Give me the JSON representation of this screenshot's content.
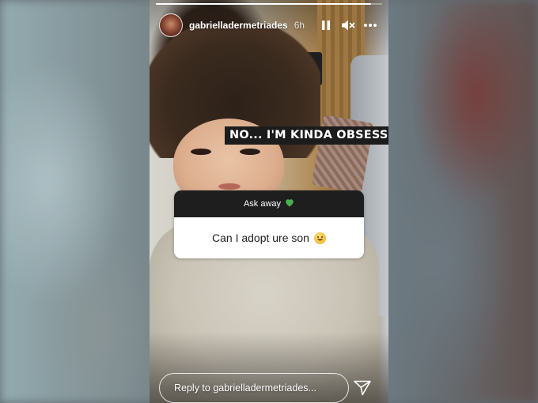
{
  "story": {
    "username": "gabrielladermetriades",
    "time_ago": "6h",
    "progress": 0.95,
    "text_sticker": "NO... I'M KINDA OBSESSED",
    "question": {
      "prompt": "Ask away",
      "answer": "Can I adopt ure son"
    },
    "reply_placeholder": "Reply to gabrielladermetriades..."
  },
  "icons": {
    "pause": "pause-icon",
    "mute": "volume-muted-icon",
    "more": "more-options-icon",
    "heart": "green-heart-icon",
    "emoji": "grinning-face-icon",
    "send": "send-icon"
  },
  "colors": {
    "sticker_dark": "#1e1e1e",
    "heart": "#4caf50",
    "text": "#ffffff"
  }
}
